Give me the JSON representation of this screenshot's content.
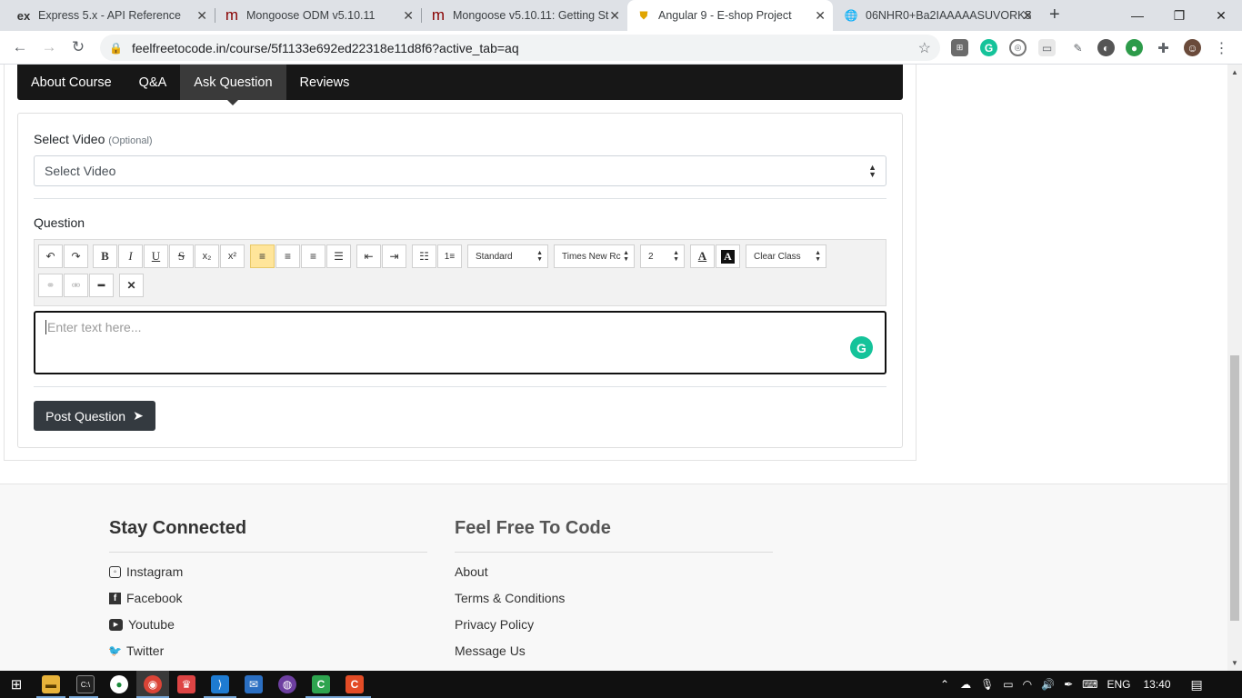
{
  "browser": {
    "tabs": [
      {
        "title": "Express 5.x - API Reference",
        "icon": "ex"
      },
      {
        "title": "Mongoose ODM v5.10.11",
        "icon": "m"
      },
      {
        "title": "Mongoose v5.10.11: Getting St",
        "icon": "m"
      },
      {
        "title": "Angular 9 - E-shop Project",
        "icon": "shield"
      },
      {
        "title": "06NHR0+Ba2IAAAAASUVORK5",
        "icon": "globe"
      }
    ],
    "url": "feelfreetocode.in/course/5f1133e692ed22318e11d8f6?active_tab=aq"
  },
  "course_tabs": [
    "About Course",
    "Q&A",
    "Ask Question",
    "Reviews"
  ],
  "form": {
    "select_video_label": "Select Video",
    "select_video_optional": "(Optional)",
    "select_video_value": "Select Video",
    "question_label": "Question",
    "editor": {
      "style_select": "Standard",
      "font_select": "Times New Rc",
      "size_select": "2",
      "class_select": "Clear Class"
    },
    "textarea_placeholder": "Enter text here...",
    "post_button": "Post Question"
  },
  "footer": {
    "col1_title": "Stay Connected",
    "col1_links": [
      "Instagram",
      "Facebook",
      "Youtube",
      "Twitter"
    ],
    "col2_title": "Feel Free To Code",
    "col2_links": [
      "About",
      "Terms & Conditions",
      "Privacy Policy",
      "Message Us"
    ]
  },
  "taskbar": {
    "lang": "ENG",
    "time": "13:40"
  }
}
